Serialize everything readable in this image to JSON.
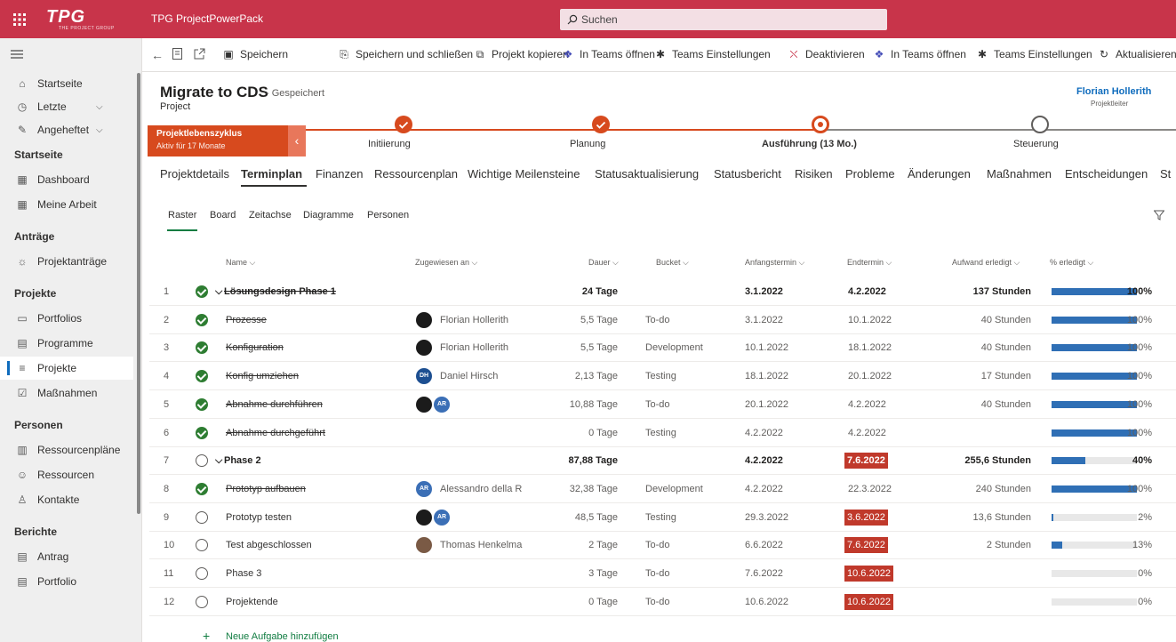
{
  "app": {
    "logo": "TPG",
    "logo_sub": "THE PROJECT GROUP",
    "name": "TPG ProjectPowerPack",
    "search_placeholder": "Suchen"
  },
  "commands": [
    "Speichern",
    "Speichern und schließen",
    "Projekt kopieren",
    "In Teams öffnen",
    "Teams Einstellungen",
    "Deaktivieren",
    "In Teams öffnen",
    "Teams Einstellungen",
    "Aktualisieren"
  ],
  "sidebar": {
    "top": [
      {
        "label": "Startseite",
        "icon": "home-icon"
      },
      {
        "label": "Letzte",
        "icon": "clock-icon"
      },
      {
        "label": "Angeheftet",
        "icon": "pin-icon"
      }
    ],
    "sections": [
      {
        "title": "Startseite",
        "items": [
          {
            "label": "Dashboard",
            "icon": "grid-icon"
          },
          {
            "label": "Meine Arbeit",
            "icon": "grid-icon"
          }
        ]
      },
      {
        "title": "Anträge",
        "items": [
          {
            "label": "Projektanträge",
            "icon": "lightbulb-icon"
          }
        ]
      },
      {
        "title": "Projekte",
        "items": [
          {
            "label": "Portfolios",
            "icon": "folder-icon"
          },
          {
            "label": "Programme",
            "icon": "stack-icon"
          },
          {
            "label": "Projekte",
            "icon": "gantt-icon",
            "selected": true
          },
          {
            "label": "Maßnahmen",
            "icon": "tasks-icon"
          }
        ]
      },
      {
        "title": "Personen",
        "items": [
          {
            "label": "Ressourcenpläne",
            "icon": "people-plan-icon"
          },
          {
            "label": "Ressourcen",
            "icon": "people-icon"
          },
          {
            "label": "Kontakte",
            "icon": "person-icon"
          }
        ]
      },
      {
        "title": "Berichte",
        "items": [
          {
            "label": "Antrag",
            "icon": "report-icon"
          },
          {
            "label": "Portfolio",
            "icon": "report-icon"
          }
        ]
      }
    ]
  },
  "header": {
    "title": "Migrate to CDS",
    "saved": "- Gespeichert",
    "type": "Project",
    "owner": "Florian Hollerith",
    "owner_role": "Projektleiter"
  },
  "lifecycle": {
    "title": "Projektlebenszyklus",
    "subtitle": "Aktiv für 17 Monate",
    "stages": [
      {
        "label": "Initiierung",
        "state": "done"
      },
      {
        "label": "Planung",
        "state": "done"
      },
      {
        "label": "Ausführung (13 Mo.)",
        "state": "current"
      },
      {
        "label": "Steuerung",
        "state": "todo"
      }
    ]
  },
  "tabs": [
    "Projektdetails",
    "Terminplan",
    "Finanzen",
    "Ressourcenplan",
    "Wichtige Meilensteine",
    "Statusaktualisierung",
    "Statusbericht",
    "Risiken",
    "Probleme",
    "Änderungen",
    "Maßnahmen",
    "Entscheidungen",
    "St"
  ],
  "active_tab": "Terminplan",
  "views": [
    "Raster",
    "Board",
    "Zeitachse",
    "Diagramme",
    "Personen"
  ],
  "columns": [
    "Name",
    "Zugewiesen an",
    "Dauer",
    "Bucket",
    "Anfangstermin",
    "Endtermin",
    "Aufwand erledigt",
    "% erledigt"
  ],
  "rows": [
    {
      "n": "1",
      "name": "Lösungsdesign Phase 1",
      "summary": true,
      "done": true,
      "assigned": "",
      "dur": "24 Tage",
      "bucket": "",
      "start": "3.1.2022",
      "end": "4.2.2022",
      "late": false,
      "effort": "137 Stunden",
      "pct": 100,
      "pct_label": "100%"
    },
    {
      "n": "2",
      "name": "Prozesse",
      "done": true,
      "assigned": "Florian Hollerith",
      "avatars": [
        "fh"
      ],
      "dur": "5,5 Tage",
      "bucket": "To-do",
      "start": "3.1.2022",
      "end": "10.1.2022",
      "late": false,
      "effort": "40 Stunden",
      "pct": 100,
      "pct_label": "100%"
    },
    {
      "n": "3",
      "name": "Konfiguration",
      "done": true,
      "assigned": "Florian Hollerith",
      "avatars": [
        "fh"
      ],
      "dur": "5,5 Tage",
      "bucket": "Development",
      "start": "10.1.2022",
      "end": "18.1.2022",
      "late": false,
      "effort": "40 Stunden",
      "pct": 100,
      "pct_label": "100%"
    },
    {
      "n": "4",
      "name": "Konfig umziehen",
      "done": true,
      "assigned": "Daniel Hirsch",
      "avatars": [
        "dh"
      ],
      "dur": "2,13 Tage",
      "bucket": "Testing",
      "start": "18.1.2022",
      "end": "20.1.2022",
      "late": false,
      "effort": "17 Stunden",
      "pct": 100,
      "pct_label": "100%"
    },
    {
      "n": "5",
      "name": "Abnahme durchführen",
      "done": true,
      "assigned": "",
      "avatars": [
        "fh",
        "ar"
      ],
      "dur": "10,88 Tage",
      "bucket": "To-do",
      "start": "20.1.2022",
      "end": "4.2.2022",
      "late": false,
      "effort": "40 Stunden",
      "pct": 100,
      "pct_label": "100%"
    },
    {
      "n": "6",
      "name": "Abnahme durchgeführt",
      "done": true,
      "assigned": "",
      "dur": "0 Tage",
      "bucket": "Testing",
      "start": "4.2.2022",
      "end": "4.2.2022",
      "late": false,
      "effort": "",
      "pct": 100,
      "pct_label": "100%"
    },
    {
      "n": "7",
      "name": "Phase 2",
      "summary": true,
      "done": false,
      "assigned": "",
      "dur": "87,88 Tage",
      "bucket": "",
      "start": "4.2.2022",
      "end": "7.6.2022",
      "late": true,
      "effort": "255,6 Stunden",
      "pct": 40,
      "pct_label": "40%"
    },
    {
      "n": "8",
      "name": "Prototyp aufbauen",
      "done": true,
      "assigned": "Alessandro della R",
      "avatars": [
        "ar"
      ],
      "dur": "32,38 Tage",
      "bucket": "Development",
      "start": "4.2.2022",
      "end": "22.3.2022",
      "late": false,
      "effort": "240 Stunden",
      "pct": 100,
      "pct_label": "100%"
    },
    {
      "n": "9",
      "name": "Prototyp testen",
      "done": false,
      "assigned": "",
      "avatars": [
        "fh",
        "ar"
      ],
      "dur": "48,5 Tage",
      "bucket": "Testing",
      "start": "29.3.2022",
      "end": "3.6.2022",
      "late": true,
      "effort": "13,6 Stunden",
      "pct": 2,
      "pct_label": "2%"
    },
    {
      "n": "10",
      "name": "Test abgeschlossen",
      "done": false,
      "assigned": "Thomas Henkelma",
      "avatars": [
        "th"
      ],
      "dur": "2 Tage",
      "bucket": "To-do",
      "start": "6.6.2022",
      "end": "7.6.2022",
      "late": true,
      "effort": "2 Stunden",
      "pct": 13,
      "pct_label": "13%"
    },
    {
      "n": "11",
      "name": "Phase 3",
      "done": false,
      "assigned": "",
      "dur": "3 Tage",
      "bucket": "To-do",
      "start": "7.6.2022",
      "end": "10.6.2022",
      "late": true,
      "effort": "",
      "pct": 0,
      "pct_label": "0%"
    },
    {
      "n": "12",
      "name": "Projektende",
      "done": false,
      "assigned": "",
      "dur": "0 Tage",
      "bucket": "To-do",
      "start": "10.6.2022",
      "end": "10.6.2022",
      "late": true,
      "effort": "",
      "pct": 0,
      "pct_label": "0%"
    }
  ],
  "avatar_initials": {
    "fh": "",
    "ar": "AR",
    "dh": "DH",
    "th": ""
  },
  "add_task": "Neue Aufgabe hinzufügen",
  "colors": {
    "brand": "#c8344a",
    "lifecycle": "#d74a1e",
    "done": "#2e7d32",
    "late": "#c0392b",
    "progress": "#2f6fb5",
    "link": "#0f6cbd"
  }
}
